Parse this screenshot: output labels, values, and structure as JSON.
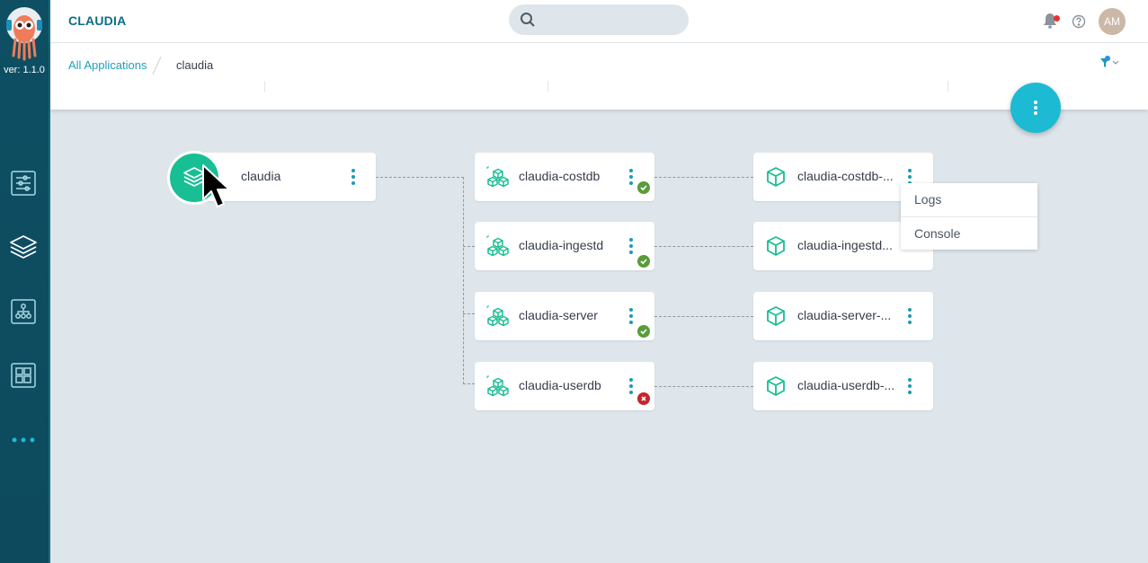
{
  "sidebar": {
    "version": "ver: 1.1.0",
    "items": [
      {
        "name": "settings-sliders-icon"
      },
      {
        "name": "layers-icon"
      },
      {
        "name": "network-tree-icon"
      },
      {
        "name": "grid-apps-icon"
      },
      {
        "name": "more-dots-icon"
      }
    ]
  },
  "header": {
    "title": "CLAUDIA",
    "search_placeholder": "",
    "avatar_initials": "AM"
  },
  "breadcrumb": {
    "root": "All Applications",
    "current": "claudia"
  },
  "graph": {
    "app": {
      "label": "claudia"
    },
    "deployments": [
      {
        "label": "claudia-costdb",
        "status": "healthy"
      },
      {
        "label": "claudia-ingestd",
        "status": "healthy"
      },
      {
        "label": "claudia-server",
        "status": "healthy"
      },
      {
        "label": "claudia-userdb",
        "status": "error"
      }
    ],
    "pods": [
      {
        "label": "claudia-costdb-..."
      },
      {
        "label": "claudia-ingestd..."
      },
      {
        "label": "claudia-server-..."
      },
      {
        "label": "claudia-userdb-..."
      }
    ]
  },
  "context_menu": {
    "items": [
      "Logs",
      "Console"
    ]
  },
  "colors": {
    "accent": "#1a9bb7",
    "healthy": "#5a9b3c",
    "error": "#c8232c",
    "app": "#18be94"
  }
}
